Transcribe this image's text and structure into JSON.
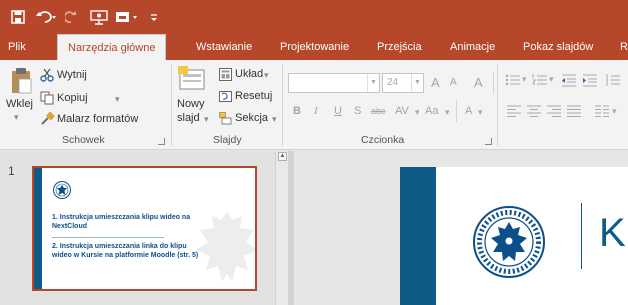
{
  "colors": {
    "accent": "#b7472a",
    "slide_blue": "#0d5b86"
  },
  "quick_access": {
    "save_icon": "save-icon",
    "undo_icon": "undo-icon",
    "redo_icon": "redo-icon",
    "present_icon": "present-from-start-icon",
    "customize_icon": "customize-qat-icon"
  },
  "tabs": [
    {
      "label": "Plik"
    },
    {
      "label": "Narzędzia główne",
      "active": true
    },
    {
      "label": "Wstawianie"
    },
    {
      "label": "Projektowanie"
    },
    {
      "label": "Przejścia"
    },
    {
      "label": "Animacje"
    },
    {
      "label": "Pokaz slajdów"
    },
    {
      "label": "R"
    }
  ],
  "ribbon": {
    "clipboard": {
      "paste_label": "Wklej",
      "cut_label": "Wytnij",
      "copy_label": "Kopiuj",
      "format_painter_label": "Malarz formatów",
      "group_label": "Schowek"
    },
    "slides": {
      "new_slide_label": "Nowy",
      "new_slide_label2": "slajd",
      "layout_label": "Układ",
      "reset_label": "Resetuj",
      "section_label": "Sekcja",
      "group_label": "Slajdy"
    },
    "font": {
      "font_name_value": "",
      "font_size_value": "24",
      "grow_label": "A",
      "shrink_label": "A",
      "clear_format_label": "A",
      "bold_label": "B",
      "italic_label": "I",
      "underline_label": "U",
      "shadow_label": "S",
      "strike_label": "abc",
      "spacing_label": "AV",
      "case_label": "Aa",
      "color_label": "A",
      "group_label": "Czcionka"
    }
  },
  "slides_panel": {
    "slide_number": "1",
    "thumbnail": {
      "item1": "1. Instrukcja umieszczania klipu wideo na NextCloud",
      "item2": "2. Instrukcja umieszczania linka do klipu wideo w Kursie na platformie Moodle (str. 5)"
    }
  },
  "editor": {
    "title_fragment": "K"
  }
}
